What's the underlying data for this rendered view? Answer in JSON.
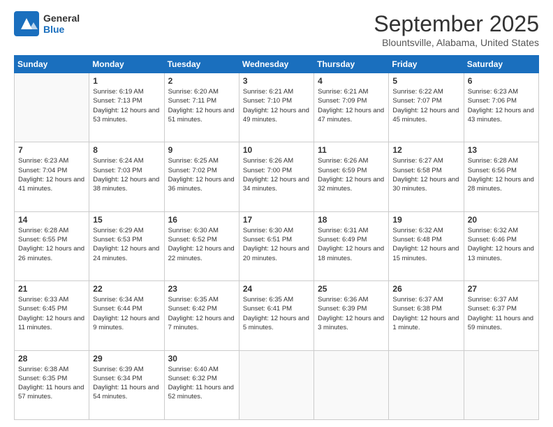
{
  "header": {
    "logo": {
      "general": "General",
      "blue": "Blue"
    },
    "month_title": "September 2025",
    "location": "Blountsville, Alabama, United States"
  },
  "weekdays": [
    "Sunday",
    "Monday",
    "Tuesday",
    "Wednesday",
    "Thursday",
    "Friday",
    "Saturday"
  ],
  "weeks": [
    [
      {
        "day": "",
        "empty": true
      },
      {
        "day": "1",
        "sunrise": "Sunrise: 6:19 AM",
        "sunset": "Sunset: 7:13 PM",
        "daylight": "Daylight: 12 hours and 53 minutes."
      },
      {
        "day": "2",
        "sunrise": "Sunrise: 6:20 AM",
        "sunset": "Sunset: 7:11 PM",
        "daylight": "Daylight: 12 hours and 51 minutes."
      },
      {
        "day": "3",
        "sunrise": "Sunrise: 6:21 AM",
        "sunset": "Sunset: 7:10 PM",
        "daylight": "Daylight: 12 hours and 49 minutes."
      },
      {
        "day": "4",
        "sunrise": "Sunrise: 6:21 AM",
        "sunset": "Sunset: 7:09 PM",
        "daylight": "Daylight: 12 hours and 47 minutes."
      },
      {
        "day": "5",
        "sunrise": "Sunrise: 6:22 AM",
        "sunset": "Sunset: 7:07 PM",
        "daylight": "Daylight: 12 hours and 45 minutes."
      },
      {
        "day": "6",
        "sunrise": "Sunrise: 6:23 AM",
        "sunset": "Sunset: 7:06 PM",
        "daylight": "Daylight: 12 hours and 43 minutes."
      }
    ],
    [
      {
        "day": "7",
        "sunrise": "Sunrise: 6:23 AM",
        "sunset": "Sunset: 7:04 PM",
        "daylight": "Daylight: 12 hours and 41 minutes."
      },
      {
        "day": "8",
        "sunrise": "Sunrise: 6:24 AM",
        "sunset": "Sunset: 7:03 PM",
        "daylight": "Daylight: 12 hours and 38 minutes."
      },
      {
        "day": "9",
        "sunrise": "Sunrise: 6:25 AM",
        "sunset": "Sunset: 7:02 PM",
        "daylight": "Daylight: 12 hours and 36 minutes."
      },
      {
        "day": "10",
        "sunrise": "Sunrise: 6:26 AM",
        "sunset": "Sunset: 7:00 PM",
        "daylight": "Daylight: 12 hours and 34 minutes."
      },
      {
        "day": "11",
        "sunrise": "Sunrise: 6:26 AM",
        "sunset": "Sunset: 6:59 PM",
        "daylight": "Daylight: 12 hours and 32 minutes."
      },
      {
        "day": "12",
        "sunrise": "Sunrise: 6:27 AM",
        "sunset": "Sunset: 6:58 PM",
        "daylight": "Daylight: 12 hours and 30 minutes."
      },
      {
        "day": "13",
        "sunrise": "Sunrise: 6:28 AM",
        "sunset": "Sunset: 6:56 PM",
        "daylight": "Daylight: 12 hours and 28 minutes."
      }
    ],
    [
      {
        "day": "14",
        "sunrise": "Sunrise: 6:28 AM",
        "sunset": "Sunset: 6:55 PM",
        "daylight": "Daylight: 12 hours and 26 minutes."
      },
      {
        "day": "15",
        "sunrise": "Sunrise: 6:29 AM",
        "sunset": "Sunset: 6:53 PM",
        "daylight": "Daylight: 12 hours and 24 minutes."
      },
      {
        "day": "16",
        "sunrise": "Sunrise: 6:30 AM",
        "sunset": "Sunset: 6:52 PM",
        "daylight": "Daylight: 12 hours and 22 minutes."
      },
      {
        "day": "17",
        "sunrise": "Sunrise: 6:30 AM",
        "sunset": "Sunset: 6:51 PM",
        "daylight": "Daylight: 12 hours and 20 minutes."
      },
      {
        "day": "18",
        "sunrise": "Sunrise: 6:31 AM",
        "sunset": "Sunset: 6:49 PM",
        "daylight": "Daylight: 12 hours and 18 minutes."
      },
      {
        "day": "19",
        "sunrise": "Sunrise: 6:32 AM",
        "sunset": "Sunset: 6:48 PM",
        "daylight": "Daylight: 12 hours and 15 minutes."
      },
      {
        "day": "20",
        "sunrise": "Sunrise: 6:32 AM",
        "sunset": "Sunset: 6:46 PM",
        "daylight": "Daylight: 12 hours and 13 minutes."
      }
    ],
    [
      {
        "day": "21",
        "sunrise": "Sunrise: 6:33 AM",
        "sunset": "Sunset: 6:45 PM",
        "daylight": "Daylight: 12 hours and 11 minutes."
      },
      {
        "day": "22",
        "sunrise": "Sunrise: 6:34 AM",
        "sunset": "Sunset: 6:44 PM",
        "daylight": "Daylight: 12 hours and 9 minutes."
      },
      {
        "day": "23",
        "sunrise": "Sunrise: 6:35 AM",
        "sunset": "Sunset: 6:42 PM",
        "daylight": "Daylight: 12 hours and 7 minutes."
      },
      {
        "day": "24",
        "sunrise": "Sunrise: 6:35 AM",
        "sunset": "Sunset: 6:41 PM",
        "daylight": "Daylight: 12 hours and 5 minutes."
      },
      {
        "day": "25",
        "sunrise": "Sunrise: 6:36 AM",
        "sunset": "Sunset: 6:39 PM",
        "daylight": "Daylight: 12 hours and 3 minutes."
      },
      {
        "day": "26",
        "sunrise": "Sunrise: 6:37 AM",
        "sunset": "Sunset: 6:38 PM",
        "daylight": "Daylight: 12 hours and 1 minute."
      },
      {
        "day": "27",
        "sunrise": "Sunrise: 6:37 AM",
        "sunset": "Sunset: 6:37 PM",
        "daylight": "Daylight: 11 hours and 59 minutes."
      }
    ],
    [
      {
        "day": "28",
        "sunrise": "Sunrise: 6:38 AM",
        "sunset": "Sunset: 6:35 PM",
        "daylight": "Daylight: 11 hours and 57 minutes."
      },
      {
        "day": "29",
        "sunrise": "Sunrise: 6:39 AM",
        "sunset": "Sunset: 6:34 PM",
        "daylight": "Daylight: 11 hours and 54 minutes."
      },
      {
        "day": "30",
        "sunrise": "Sunrise: 6:40 AM",
        "sunset": "Sunset: 6:32 PM",
        "daylight": "Daylight: 11 hours and 52 minutes."
      },
      {
        "day": "",
        "empty": true
      },
      {
        "day": "",
        "empty": true
      },
      {
        "day": "",
        "empty": true
      },
      {
        "day": "",
        "empty": true
      }
    ]
  ]
}
